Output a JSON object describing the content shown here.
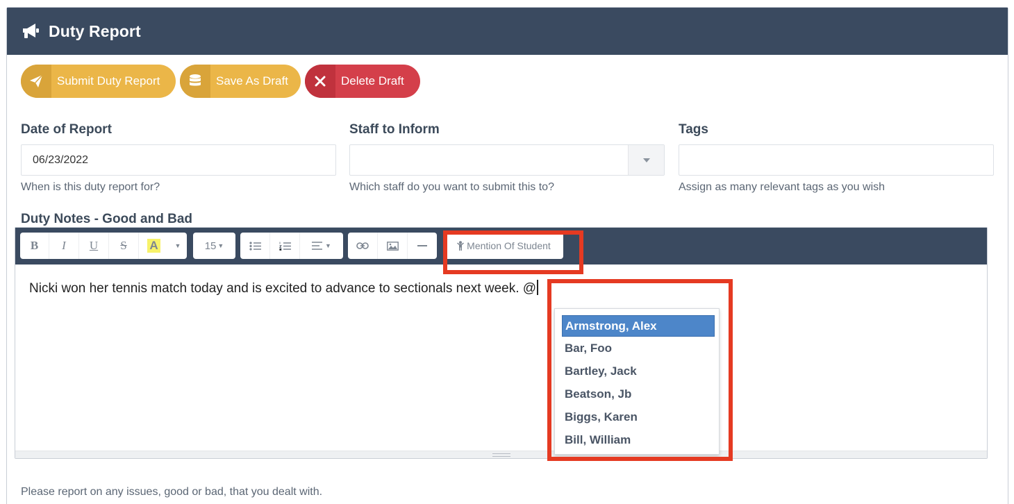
{
  "header": {
    "title": "Duty Report",
    "icon": "megaphone-icon"
  },
  "actions": {
    "submit_label": "Submit Duty Report",
    "save_label": "Save As Draft",
    "delete_label": "Delete Draft"
  },
  "fields": {
    "date": {
      "label": "Date of Report",
      "value": "06/23/2022",
      "help": "When is this duty report for?"
    },
    "staff": {
      "label": "Staff to Inform",
      "value": "",
      "help": "Which staff do you want to submit this to?"
    },
    "tags": {
      "label": "Tags",
      "value": "",
      "help": "Assign as many relevant tags as you wish"
    }
  },
  "notes": {
    "label": "Duty Notes - Good and Bad",
    "content": "Nicki won her tennis match today and is excited to advance to sectionals next week.  @",
    "help": "Please report on any issues, good or bad, that you dealt with."
  },
  "toolbar": {
    "font_size": "15",
    "mention_label": "Mention Of Student",
    "bold": "B",
    "italic": "I",
    "underline": "U",
    "strike": "S",
    "color": "A"
  },
  "mention_suggestions": [
    {
      "name": "Armstrong, Alex",
      "selected": true
    },
    {
      "name": "Bar, Foo",
      "selected": false
    },
    {
      "name": "Bartley, Jack",
      "selected": false
    },
    {
      "name": "Beatson, Jb",
      "selected": false
    },
    {
      "name": "Biggs, Karen",
      "selected": false
    },
    {
      "name": "Bill, William",
      "selected": false
    }
  ],
  "colors": {
    "header_bg": "#3a4a60",
    "primary_yellow": "#ebb648",
    "danger_red": "#d43f4a",
    "selection_blue": "#4d86c9",
    "highlight_red": "#e53a22"
  }
}
